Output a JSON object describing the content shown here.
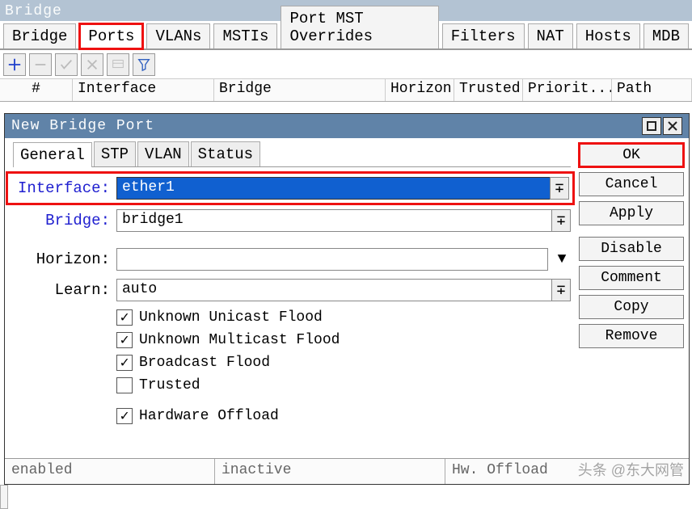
{
  "window": {
    "title": "Bridge"
  },
  "tabs": {
    "items": [
      "Bridge",
      "Ports",
      "VLANs",
      "MSTIs",
      "Port MST Overrides",
      "Filters",
      "NAT",
      "Hosts",
      "MDB"
    ],
    "active": "Ports",
    "highlighted": "Ports"
  },
  "table": {
    "columns": [
      "#",
      "Interface",
      "Bridge",
      "Horizon",
      "Trusted",
      "Priorit...",
      "Path"
    ]
  },
  "dialog": {
    "title": "New Bridge Port",
    "tabs": [
      "General",
      "STP",
      "VLAN",
      "Status"
    ],
    "active_tab": "General",
    "fields": {
      "interface": {
        "label": "Interface:",
        "value": "ether1"
      },
      "bridge": {
        "label": "Bridge:",
        "value": "bridge1"
      },
      "horizon": {
        "label": "Horizon:",
        "value": ""
      },
      "learn": {
        "label": "Learn:",
        "value": "auto"
      }
    },
    "checkboxes": {
      "unknown_unicast": {
        "label": "Unknown Unicast Flood",
        "checked": true
      },
      "unknown_multicast": {
        "label": "Unknown Multicast Flood",
        "checked": true
      },
      "broadcast": {
        "label": "Broadcast Flood",
        "checked": true
      },
      "trusted": {
        "label": "Trusted",
        "checked": false
      },
      "hw_offload": {
        "label": "Hardware Offload",
        "checked": true
      }
    },
    "buttons": {
      "ok": "OK",
      "cancel": "Cancel",
      "apply": "Apply",
      "disable": "Disable",
      "comment": "Comment",
      "copy": "Copy",
      "remove": "Remove"
    },
    "status": {
      "left": "enabled",
      "mid": "inactive",
      "right": "Hw. Offload"
    }
  },
  "watermark": "头条 @东大网管"
}
